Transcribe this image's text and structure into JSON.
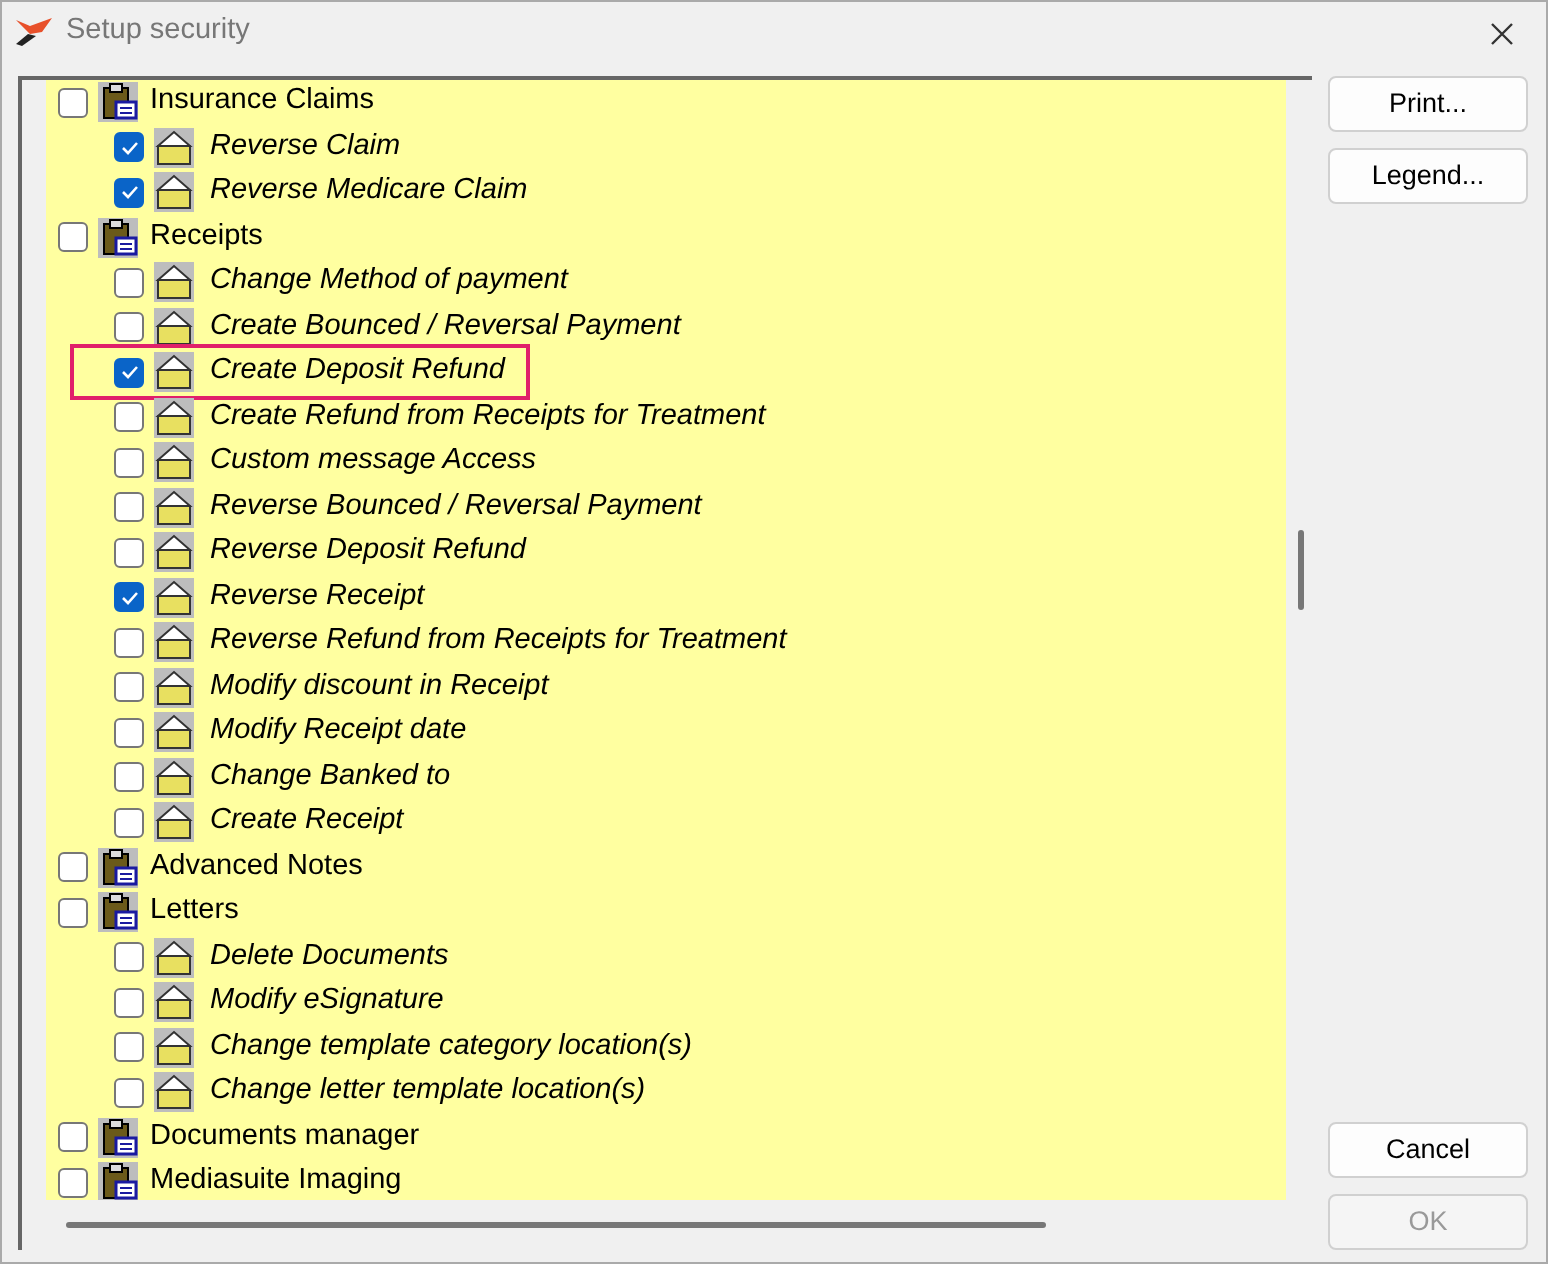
{
  "window": {
    "title": "Setup security"
  },
  "tree": [
    {
      "label": "Insurance Claims",
      "checked": false,
      "children": [
        {
          "label": "Reverse Claim",
          "checked": true,
          "highlighted": false
        },
        {
          "label": "Reverse Medicare Claim",
          "checked": true,
          "highlighted": false
        }
      ]
    },
    {
      "label": "Receipts",
      "checked": false,
      "children": [
        {
          "label": "Change Method of payment",
          "checked": false,
          "highlighted": false
        },
        {
          "label": "Create Bounced / Reversal Payment",
          "checked": false,
          "highlighted": false
        },
        {
          "label": "Create Deposit Refund",
          "checked": true,
          "highlighted": true
        },
        {
          "label": "Create Refund from Receipts for Treatment",
          "checked": false,
          "highlighted": false
        },
        {
          "label": "Custom message Access",
          "checked": false,
          "highlighted": false
        },
        {
          "label": "Reverse Bounced / Reversal Payment",
          "checked": false,
          "highlighted": false
        },
        {
          "label": "Reverse Deposit Refund",
          "checked": false,
          "highlighted": false
        },
        {
          "label": "Reverse Receipt",
          "checked": true,
          "highlighted": false
        },
        {
          "label": "Reverse Refund from Receipts for Treatment",
          "checked": false,
          "highlighted": false
        },
        {
          "label": "Modify discount in Receipt",
          "checked": false,
          "highlighted": false
        },
        {
          "label": "Modify Receipt date",
          "checked": false,
          "highlighted": false
        },
        {
          "label": "Change Banked to",
          "checked": false,
          "highlighted": false
        },
        {
          "label": "Create Receipt",
          "checked": false,
          "highlighted": false
        }
      ]
    },
    {
      "label": "Advanced Notes",
      "checked": false
    },
    {
      "label": "Letters",
      "checked": false,
      "children": [
        {
          "label": "Delete Documents",
          "checked": false,
          "highlighted": false
        },
        {
          "label": "Modify eSignature",
          "checked": false,
          "highlighted": false
        },
        {
          "label": "Change template category location(s)",
          "checked": false,
          "highlighted": false
        },
        {
          "label": "Change letter template location(s)",
          "checked": false,
          "highlighted": false
        }
      ]
    },
    {
      "label": "Documents manager",
      "checked": false
    },
    {
      "label": "Mediasuite Imaging",
      "checked": false
    }
  ],
  "buttons": [
    {
      "label": "Print...",
      "disabled": false
    },
    {
      "label": "Legend...",
      "disabled": false
    },
    {
      "label": "Cancel",
      "disabled": false
    },
    {
      "label": "OK",
      "disabled": true
    }
  ]
}
